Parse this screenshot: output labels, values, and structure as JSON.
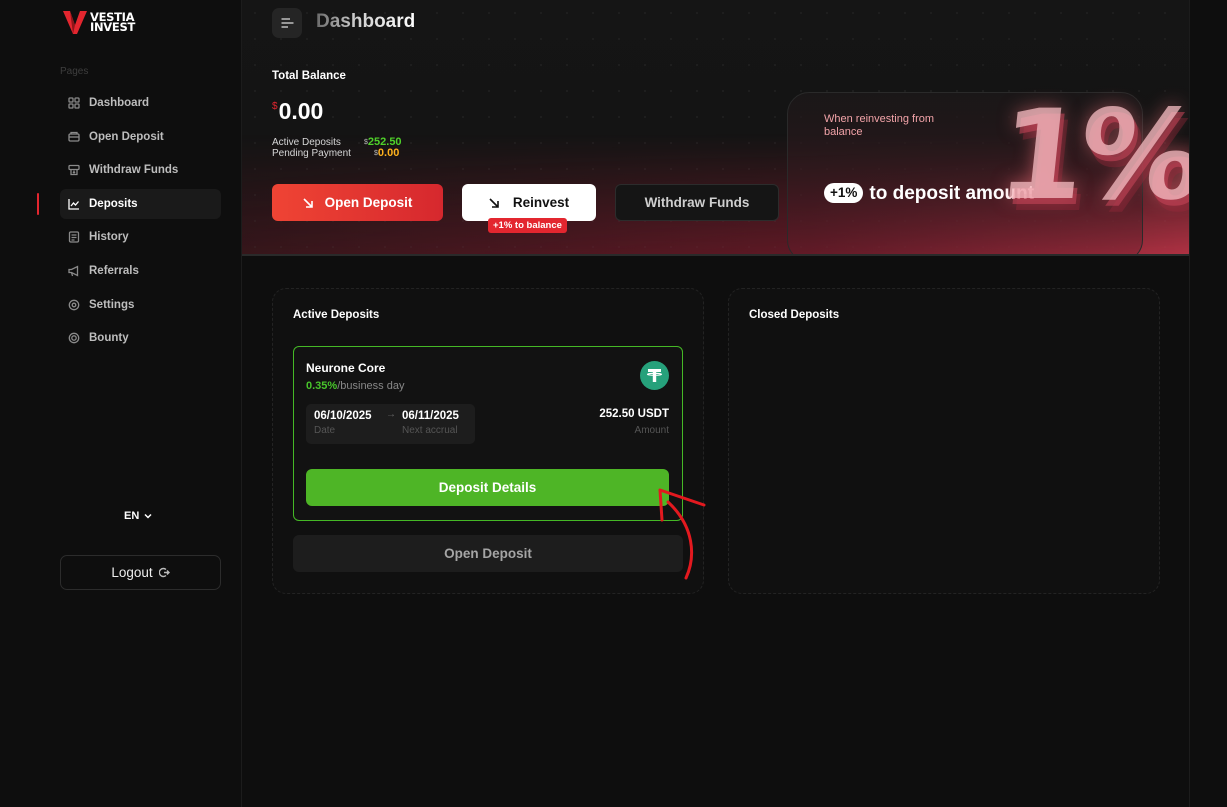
{
  "brand": {
    "line1": "VESTIA",
    "line2": "INVEST",
    "accent": "#e3262f"
  },
  "sidebar": {
    "section_label": "Pages",
    "items": [
      {
        "label": "Dashboard",
        "icon": "grid-icon",
        "active": false
      },
      {
        "label": "Open Deposit",
        "icon": "wallet-icon",
        "active": false
      },
      {
        "label": "Withdraw Funds",
        "icon": "withdraw-icon",
        "active": false
      },
      {
        "label": "Deposits",
        "icon": "chart-line-icon",
        "active": true
      },
      {
        "label": "History",
        "icon": "document-icon",
        "active": false
      },
      {
        "label": "Referrals",
        "icon": "megaphone-icon",
        "active": false
      },
      {
        "label": "Settings",
        "icon": "gear-icon",
        "active": false
      },
      {
        "label": "Bounty",
        "icon": "target-icon",
        "active": false
      }
    ],
    "language": "EN",
    "logout_label": "Logout"
  },
  "header": {
    "title": "Dashboard",
    "total_balance_label": "Total Balance",
    "currency_symbol": "$",
    "total_balance": "0.00",
    "active_deposits_label": "Active Deposits",
    "active_deposits_value": "252.50",
    "pending_payment_label": "Pending Payment",
    "pending_payment_value": "0.00",
    "open_deposit_label": "Open Deposit",
    "reinvest_label": "Reinvest",
    "reinvest_badge": "+1% to balance",
    "withdraw_label": "Withdraw Funds"
  },
  "promo": {
    "note": "When reinvesting from balance",
    "pill": "+1%",
    "headline": "to deposit amount",
    "big_text": "1%"
  },
  "active_deposits": {
    "title": "Active Deposits",
    "cards": [
      {
        "plan_name": "Neurone Core",
        "rate": "0.35%",
        "rate_unit": "/business day",
        "date_value": "06/10/2025",
        "date_label": "Date",
        "next_value": "06/11/2025",
        "next_label": "Next accrual",
        "amount_value": "252.50 USDT",
        "amount_label": "Amount",
        "details_label": "Deposit Details"
      }
    ],
    "open_deposit_label": "Open Deposit"
  },
  "closed_deposits": {
    "title": "Closed Deposits"
  },
  "colors": {
    "green": "#4eb526",
    "orange": "#ffb21d",
    "red": "#e3262f",
    "tether": "#26a17b"
  }
}
